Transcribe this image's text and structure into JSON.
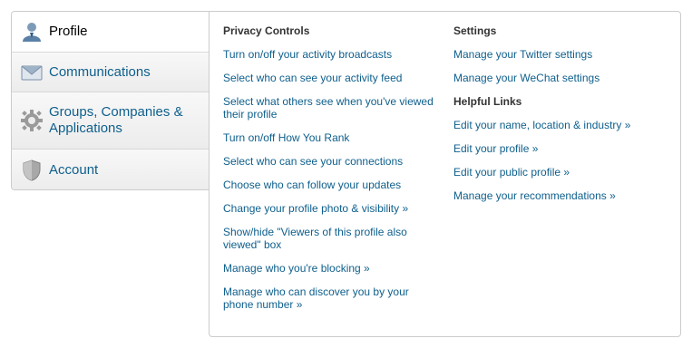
{
  "tabs": [
    {
      "label": "Profile",
      "icon": "user-icon",
      "active": true
    },
    {
      "label": "Communications",
      "icon": "envelope-icon",
      "active": false
    },
    {
      "label": "Groups, Companies & Applications",
      "icon": "gear-icon",
      "active": false
    },
    {
      "label": "Account",
      "icon": "shield-icon",
      "active": false
    }
  ],
  "privacy": {
    "title": "Privacy Controls",
    "links": [
      "Turn on/off your activity broadcasts",
      "Select who can see your activity feed",
      "Select what others see when you've viewed their profile",
      "Turn on/off How You Rank",
      "Select who can see your connections",
      "Choose who can follow your updates",
      "Change your profile photo & visibility »",
      "Show/hide \"Viewers of this profile also viewed\" box",
      "Manage who you're blocking »",
      "Manage who can discover you by your phone number »"
    ]
  },
  "settings": {
    "title": "Settings",
    "links": [
      "Manage your Twitter settings",
      "Manage your WeChat settings"
    ]
  },
  "helpful": {
    "title": "Helpful Links",
    "links": [
      "Edit your name, location & industry »",
      "Edit your profile »",
      "Edit your public profile »",
      "Manage your recommendations »"
    ]
  },
  "colors": {
    "link": "#0e5f8c",
    "heading": "#333333",
    "border": "#cccccc"
  }
}
